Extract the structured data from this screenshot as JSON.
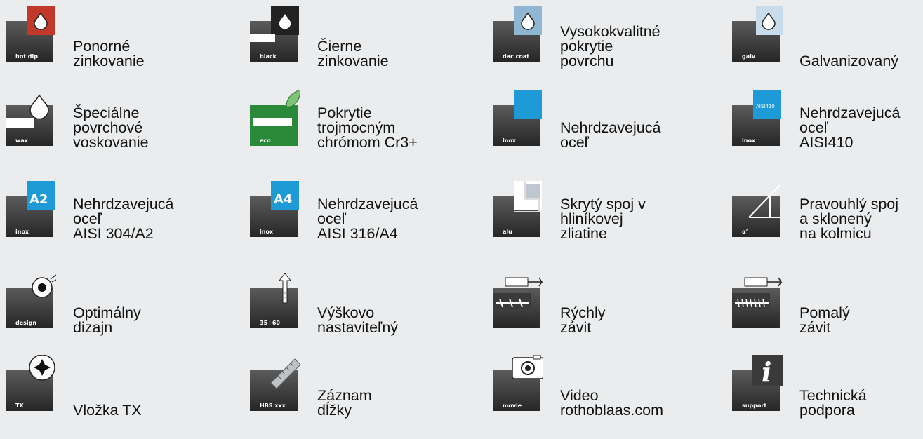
{
  "colors": {
    "tile_dark": "#3a3a3a",
    "tile_light": "#666666",
    "hot_dip": "#c0392b",
    "galv_blue": "#8fb7d4",
    "inox_blue": "#1e9ad6",
    "eco_green": "#2a8a3a",
    "white": "#ffffff"
  },
  "items": [
    {
      "name": "hot-dip-galvanizing",
      "icon": "hot-dip-icon",
      "badge": "hot dip",
      "lines": [
        "Ponorné",
        "zinkovanie"
      ]
    },
    {
      "name": "black-galvanizing",
      "icon": "black-icon",
      "badge": "black",
      "lines": [
        "Čierne",
        "zinkovanie"
      ]
    },
    {
      "name": "high-quality-coating",
      "icon": "dac-coat-icon",
      "badge": "dac coat",
      "lines": [
        "Vysokokvalitné",
        "pokrytie",
        "povrchu"
      ]
    },
    {
      "name": "galvanized",
      "icon": "galv-icon",
      "badge": "galv",
      "lines": [
        "Galvanizovaný"
      ]
    },
    {
      "name": "wax-coating",
      "icon": "wax-icon",
      "badge": "wax",
      "lines": [
        "Špeciálne",
        "povrchové",
        "voskovanie"
      ]
    },
    {
      "name": "trivalent-chrome",
      "icon": "eco-icon",
      "badge": "eco",
      "lines": [
        "Pokrytie",
        "trojmocným",
        "chrómom Cr3+"
      ]
    },
    {
      "name": "stainless-steel",
      "icon": "inox-icon",
      "badge": "inox",
      "lines": [
        "Nehrdzavejucá",
        "oceľ"
      ]
    },
    {
      "name": "stainless-aisi410",
      "icon": "inox-410-icon",
      "badge": "inox",
      "sub": "AISI410",
      "lines": [
        "Nehrdzavejucá",
        "oceľ",
        "AISI410"
      ]
    },
    {
      "name": "stainless-a2",
      "icon": "inox-a2-icon",
      "badge": "inox",
      "sub": "A2",
      "lines": [
        "Nehrdzavejucá",
        "oceľ",
        "AISI 304/A2"
      ]
    },
    {
      "name": "stainless-a4",
      "icon": "inox-a4-icon",
      "badge": "inox",
      "sub": "A4",
      "lines": [
        "Nehrdzavejucá",
        "oceľ",
        "AISI 316/A4"
      ]
    },
    {
      "name": "hidden-joint",
      "icon": "alu-icon",
      "badge": "alu",
      "lines": [
        "Skrytý spoj v",
        "hliníkovej",
        "zliatine"
      ]
    },
    {
      "name": "angle-joint",
      "icon": "angle-icon",
      "badge": "α°",
      "lines": [
        "Pravouhlý spoj",
        "a sklonený",
        "na kolmicu"
      ]
    },
    {
      "name": "optimal-design",
      "icon": "design-icon",
      "badge": "design",
      "lines": [
        "Optimálny",
        "dizajn"
      ]
    },
    {
      "name": "height-adjustable",
      "icon": "height-icon",
      "badge": "35÷60",
      "lines": [
        "Výškovo",
        "nastaviteľný"
      ]
    },
    {
      "name": "fast-thread",
      "icon": "fast-thread-icon",
      "badge": "",
      "lines": [
        "Rýchly",
        "závit"
      ]
    },
    {
      "name": "slow-thread",
      "icon": "slow-thread-icon",
      "badge": "",
      "lines": [
        "Pomalý",
        "závit"
      ]
    },
    {
      "name": "tx-insert",
      "icon": "tx-icon",
      "badge": "TX",
      "lines": [
        "Vložka TX"
      ]
    },
    {
      "name": "length-mark",
      "icon": "ruler-icon",
      "badge": "HBS xxx",
      "lines": [
        "Záznam",
        "dĺžky"
      ]
    },
    {
      "name": "video",
      "icon": "camera-icon",
      "badge": "movie",
      "lines": [
        "Video",
        "rothoblaas.com"
      ]
    },
    {
      "name": "tech-support",
      "icon": "info-icon",
      "badge": "support",
      "lines": [
        "Technická",
        "podpora"
      ]
    }
  ]
}
